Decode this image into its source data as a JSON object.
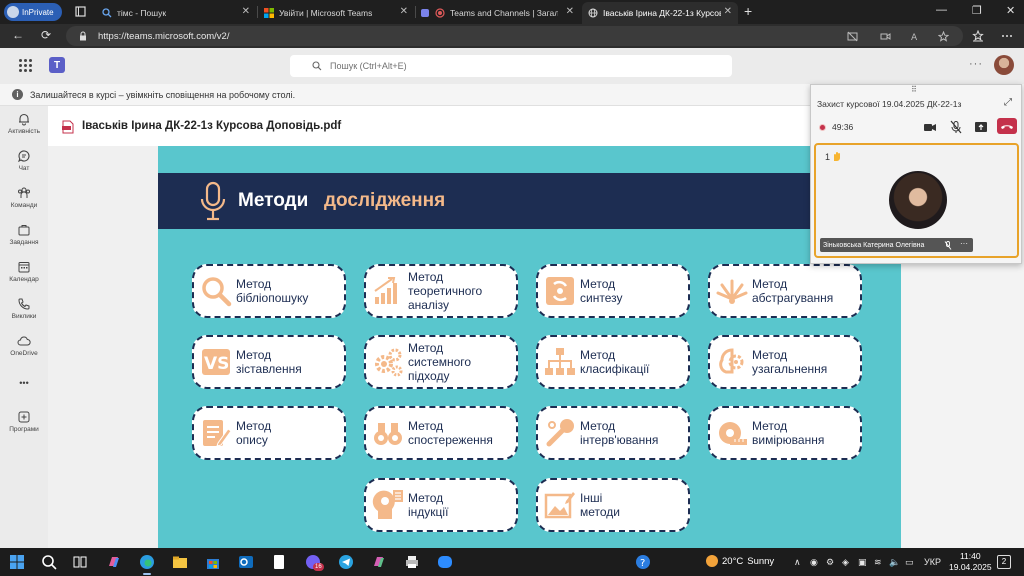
{
  "browser": {
    "inprivate_label": "InPrivate",
    "tabs": [
      {
        "title": "тімс - Пошук"
      },
      {
        "title": "Увійти | Microsoft Teams"
      },
      {
        "title": "Teams and Channels | Загал"
      },
      {
        "title": "Іваськів Ірина ДК-22-1з Курсова"
      }
    ],
    "new_tab": "+",
    "url": "https://teams.microsoft.com/v2/"
  },
  "teams": {
    "search_placeholder": "Пошук (Ctrl+Alt+E)",
    "banner_text": "Залишайтеся в курсі – увімкніть сповіщення на робочому столі.",
    "rail": [
      {
        "label": "Активність",
        "icon": "bell-icon"
      },
      {
        "label": "Чат",
        "icon": "chat-icon"
      },
      {
        "label": "Команди",
        "icon": "teams-icon"
      },
      {
        "label": "Завдання",
        "icon": "assignments-icon"
      },
      {
        "label": "Календар",
        "icon": "calendar-icon"
      },
      {
        "label": "Виклики",
        "icon": "phone-icon"
      },
      {
        "label": "OneDrive",
        "icon": "cloud-icon"
      },
      {
        "label": "Програми",
        "icon": "apps-icon"
      }
    ],
    "more_dots": "•••",
    "file_name": "Іваськів Ірина ДК-22-1з Курсова Доповідь.pdf"
  },
  "slide": {
    "title_white": "Методи",
    "title_accent": "дослідження",
    "methods": [
      {
        "l1": "Метод",
        "l2": "бібліопошуку",
        "l3": ""
      },
      {
        "l1": "Метод",
        "l2": "теоретичного",
        "l3": "аналізу"
      },
      {
        "l1": "Метод",
        "l2": "синтезу",
        "l3": ""
      },
      {
        "l1": "Метод",
        "l2": "абстрагування",
        "l3": ""
      },
      {
        "l1": "Метод",
        "l2": "зіставлення",
        "l3": ""
      },
      {
        "l1": "Метод",
        "l2": "системного",
        "l3": "підходу"
      },
      {
        "l1": "Метод",
        "l2": "класифікації",
        "l3": ""
      },
      {
        "l1": "Метод",
        "l2": "узагальнення",
        "l3": ""
      },
      {
        "l1": "Метод",
        "l2": "опису",
        "l3": ""
      },
      {
        "l1": "Метод",
        "l2": "спостереження",
        "l3": ""
      },
      {
        "l1": "Метод",
        "l2": "інтерв'ювання",
        "l3": ""
      },
      {
        "l1": "Метод",
        "l2": "вимірювання",
        "l3": ""
      },
      {
        "l1": "Метод",
        "l2": "індукції",
        "l3": ""
      },
      {
        "l1": "Інші",
        "l2": "методи",
        "l3": ""
      }
    ],
    "colors": {
      "teal": "#59c6cd",
      "navy": "#1d2d52",
      "peach": "#f4b98a"
    }
  },
  "call": {
    "title": "Захист курсової 19.04.2025 ДК-22-1з",
    "timer": "49:36",
    "raised_hands": "1",
    "participant": "Зіньковська Катерина Олегівна"
  },
  "taskbar": {
    "temperature": "20°C",
    "weather": "Sunny",
    "language": "УКР",
    "time": "11:40",
    "date": "19.04.2025",
    "notifications": "2",
    "viber_badge": "16"
  }
}
